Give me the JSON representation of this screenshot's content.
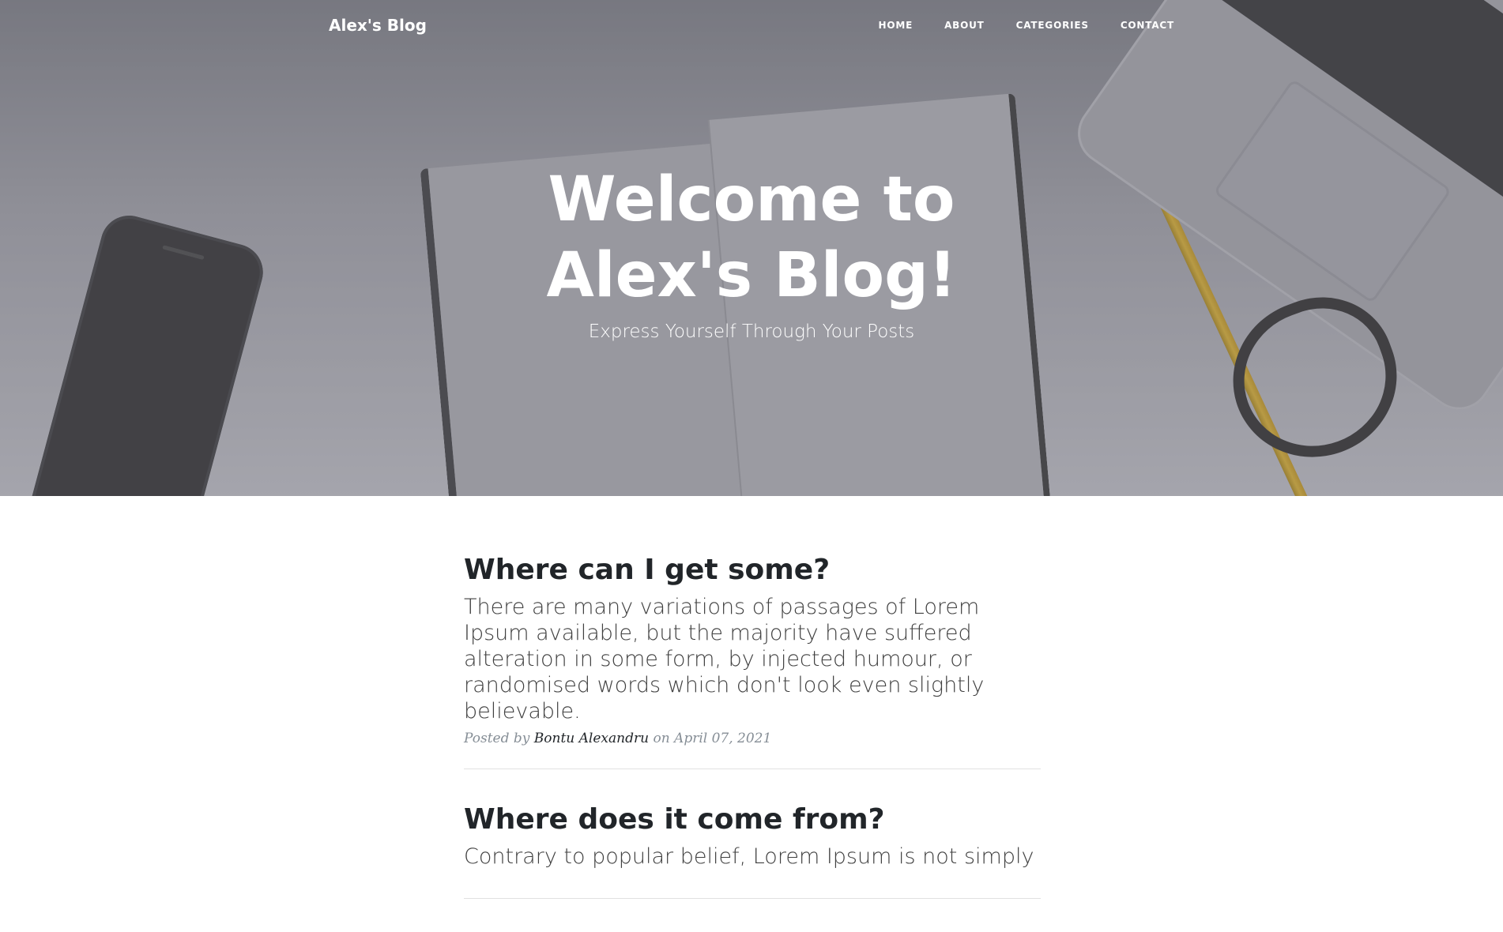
{
  "navbar": {
    "brand": "Alex's Blog",
    "links": [
      "HOME",
      "ABOUT",
      "CATEGORIES",
      "CONTACT"
    ]
  },
  "hero": {
    "title": "Welcome to Alex's Blog!",
    "subtitle": "Express Yourself Through Your Posts"
  },
  "posts": [
    {
      "title": "Where can I get some?",
      "excerpt": "There are many variations of passages of Lorem Ipsum available, but the majority have suffered alteration in some form, by injected humour, or randomised words which don't look even slightly believable.",
      "meta_prefix": "Posted by",
      "author": "Bontu Alexandru",
      "meta_on": "on",
      "date": "April 07, 2021"
    },
    {
      "title": "Where does it come from?",
      "excerpt": "Contrary to popular belief, Lorem Ipsum is not simply"
    }
  ],
  "colors": {
    "hero_overlay": "#7d7e86",
    "text_dark": "#212529",
    "meta_gray": "#868e96"
  }
}
